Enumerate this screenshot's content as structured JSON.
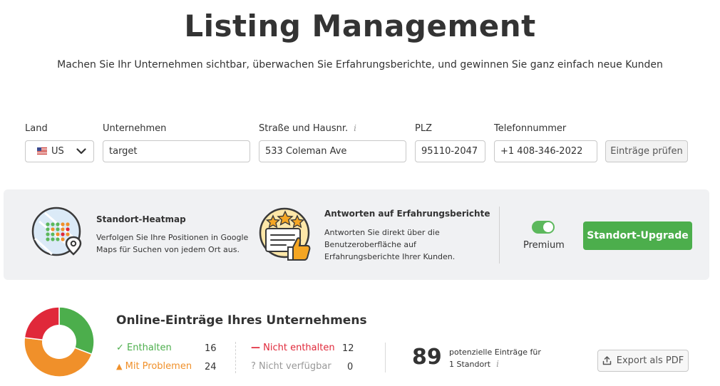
{
  "header": {
    "title": "Listing Management",
    "subtitle": "Machen Sie Ihr Unternehmen sichtbar, überwachen Sie Erfahrungsberichte, und gewinnen Sie ganz einfach neue Kunden"
  },
  "form": {
    "country_label": "Land",
    "country_value": "US",
    "company_label": "Unternehmen",
    "company_value": "target",
    "street_label": "Straße und Hausnr.",
    "street_value": "533 Coleman Ave",
    "zip_label": "PLZ",
    "zip_value": "95110-2047",
    "phone_label": "Telefonnummer",
    "phone_value": "+1 408-346-2022",
    "check_button": "Einträge prüfen",
    "info_glyph": "i"
  },
  "promo": {
    "heatmap_title": "Standort-Heatmap",
    "heatmap_text_1": "Verfolgen Sie Ihre Positionen in Google",
    "heatmap_text_2": "Maps für Suchen von jedem Ort aus.",
    "reviews_title": "Antworten auf Erfahrungsberichte",
    "reviews_text_1": "Antworten Sie direkt über die",
    "reviews_text_2": "Benutzeroberfläche auf",
    "reviews_text_3": "Erfahrungsberichte Ihrer Kunden.",
    "premium_label": "Premium",
    "premium_enabled": true,
    "upgrade_button": "Standort-Upgrade"
  },
  "listings": {
    "title": "Online-Einträge Ihres Unternehmens",
    "present_label": "Enthalten",
    "present_count": "16",
    "problems_label": "Mit Problemen",
    "problems_count": "24",
    "missing_label": "Nicht enthalten",
    "missing_count": "12",
    "unavailable_label": "Nicht verfügbar",
    "unavailable_count": "0",
    "potential_count": "89",
    "potential_text_1": "potenzielle Einträge für",
    "potential_text_2": "1 Standort",
    "export_button": "Export als PDF"
  },
  "colors": {
    "green": "#4cae4c",
    "orange": "#f0902a",
    "red": "#e0283a",
    "gray": "#999999"
  },
  "icons": {
    "check": "✓",
    "warning": "▲",
    "minus": "—",
    "question": "?"
  }
}
